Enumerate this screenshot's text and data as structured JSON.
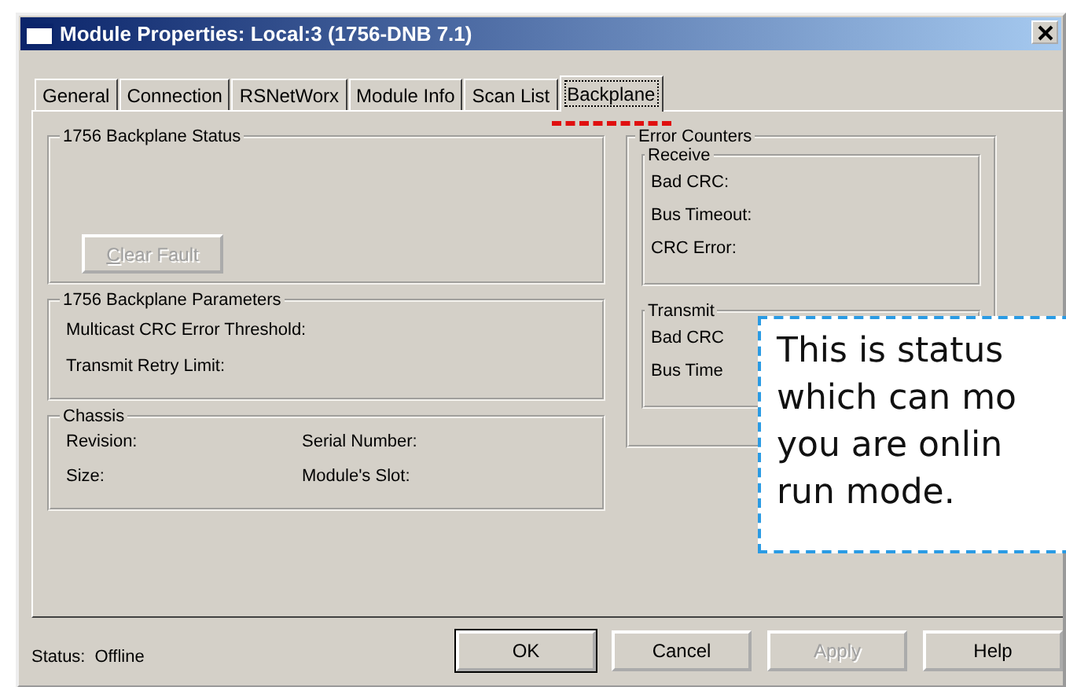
{
  "window": {
    "title": "Module Properties: Local:3 (1756-DNB 7.1)"
  },
  "tabs": [
    {
      "label": "General",
      "selected": false,
      "marked": false
    },
    {
      "label": "Connection",
      "selected": false,
      "marked": false
    },
    {
      "label": "RSNetWorx",
      "selected": false,
      "marked": false
    },
    {
      "label": "Module Info",
      "selected": false,
      "marked": false
    },
    {
      "label": "Scan List",
      "selected": false,
      "marked": false
    },
    {
      "label": "Backplane",
      "selected": true,
      "marked": true
    }
  ],
  "backplane_status": {
    "title": "1756 Backplane Status",
    "clear_fault_button": {
      "label": "Clear Fault",
      "disabled": true
    }
  },
  "backplane_parameters": {
    "title": "1756 Backplane Parameters",
    "fields": [
      "Multicast CRC Error Threshold:",
      "Transmit Retry Limit:"
    ]
  },
  "chassis": {
    "title": "Chassis",
    "fields": [
      "Revision:",
      "Serial Number:",
      "Size:",
      "Module's Slot:"
    ]
  },
  "error_counters": {
    "title": "Error Counters",
    "receive": {
      "title": "Receive",
      "fields": [
        "Bad CRC:",
        "Bus Timeout:",
        "CRC Error:"
      ]
    },
    "transmit": {
      "title": "Transmit",
      "fields": [
        "Bad CRC",
        "Bus Time"
      ]
    }
  },
  "status_bar": {
    "label": "Status:",
    "value": "Offline"
  },
  "buttons": [
    {
      "label": "OK",
      "default": true,
      "disabled": false
    },
    {
      "label": "Cancel",
      "default": false,
      "disabled": false
    },
    {
      "label": "Apply",
      "default": false,
      "disabled": true
    },
    {
      "label": "Help",
      "default": false,
      "disabled": false
    }
  ],
  "callout": {
    "lines": [
      "This is status",
      "which can mo",
      "you are onlin",
      "run mode."
    ]
  }
}
